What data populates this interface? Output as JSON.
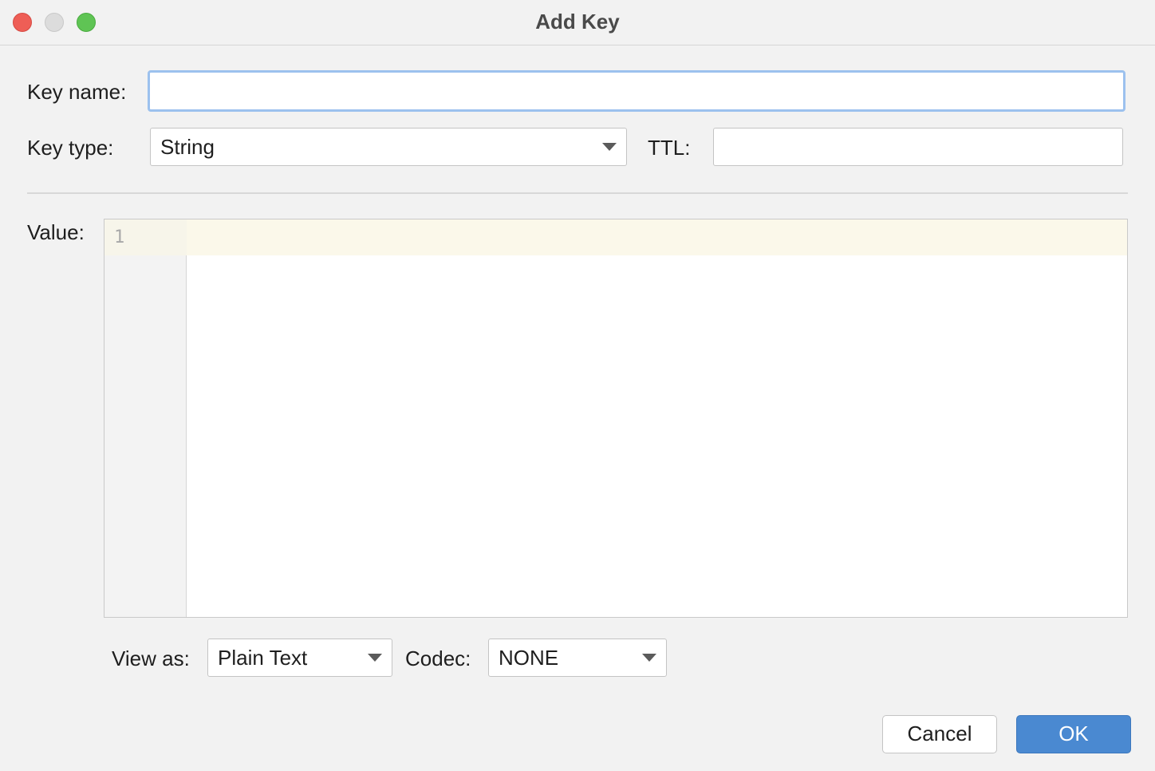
{
  "window": {
    "title": "Add Key"
  },
  "form": {
    "key_name_label": "Key name:",
    "key_name_value": "",
    "key_type_label": "Key type:",
    "key_type_value": "String",
    "ttl_label": "TTL:",
    "ttl_value": "",
    "value_label": "Value:",
    "line_number": "1"
  },
  "options": {
    "view_as_label": "View as:",
    "view_as_value": "Plain Text",
    "codec_label": "Codec:",
    "codec_value": "NONE"
  },
  "buttons": {
    "cancel_label": "Cancel",
    "ok_label": "OK"
  },
  "colors": {
    "accent": "#4a89d1",
    "focus_ring": "#9cc1ee",
    "close": "#ee5e56",
    "maximize": "#5fc454"
  }
}
